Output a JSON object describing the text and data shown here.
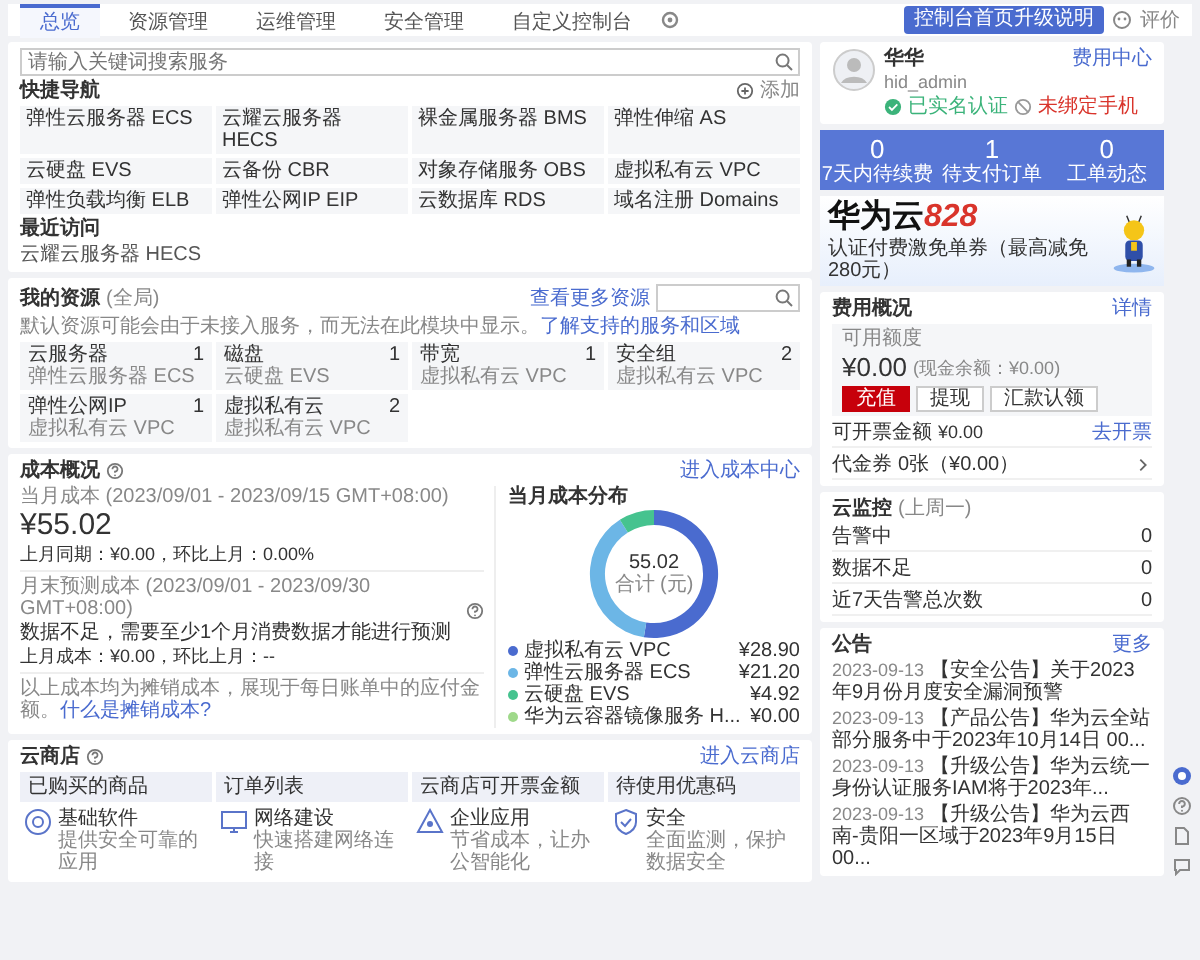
{
  "top_bar": {
    "tabs": [
      {
        "label": "总览",
        "selected": true
      },
      {
        "label": "资源管理",
        "selected": false
      },
      {
        "label": "运维管理",
        "selected": false
      },
      {
        "label": "安全管理",
        "selected": false
      },
      {
        "label": "自定义控制台",
        "selected": false
      }
    ],
    "upgrade_button": "控制台首页升级说明",
    "feedback": "评价"
  },
  "quick_nav": {
    "search": {
      "placeholder": "请输入关键词搜索服务"
    },
    "title": "快捷导航",
    "add": "添加",
    "items": [
      "弹性云服务器 ECS",
      "云耀云服务器 HECS",
      "裸金属服务器 BMS",
      "弹性伸缩 AS",
      "云硬盘 EVS",
      "云备份 CBR",
      "对象存储服务 OBS",
      "虚拟私有云 VPC",
      "弹性负载均衡 ELB",
      "弹性公网IP EIP",
      "云数据库 RDS",
      "域名注册 Domains"
    ],
    "recent_title": "最近访问",
    "recent": [
      "云耀云服务器 HECS"
    ]
  },
  "resources": {
    "title": "我的资源",
    "scope": "(全局)",
    "note": "默认资源可能会由于未接入服务，而无法在此模块中显示。",
    "note_link": "了解支持的服务和区域",
    "more": "查看更多资源",
    "items": [
      {
        "name": "云服务器",
        "service": "弹性云服务器 ECS",
        "count": "1"
      },
      {
        "name": "磁盘",
        "service": "云硬盘 EVS",
        "count": "1"
      },
      {
        "name": "带宽",
        "service": "虚拟私有云 VPC",
        "count": "1"
      },
      {
        "name": "安全组",
        "service": "虚拟私有云 VPC",
        "count": "2"
      },
      {
        "name": "弹性公网IP",
        "service": "虚拟私有云 VPC",
        "count": "1"
      },
      {
        "name": "虚拟私有云",
        "service": "虚拟私有云 VPC",
        "count": "2"
      }
    ]
  },
  "cost": {
    "title": "成本概况",
    "link": "进入成本中心",
    "month_label": "当月成本 (2023/09/01 - 2023/09/15 GMT+08:00)",
    "month_amount": "¥55.02",
    "month_compare": "上月同期：¥0.00，环比上月：0.00%",
    "forecast_label": "月末预测成本 (2023/09/01 - 2023/09/30 GMT+08:00)",
    "forecast_note": "数据不足，需要至少1个月消费数据才能进行预测",
    "forecast_compare": "上月成本：¥0.00，环比上月：--",
    "footer": "以上成本均为摊销成本，展现于每日账单中的应付金额。",
    "footer_link": "什么是摊销成本?",
    "chart_data": {
      "type": "donut",
      "title": "当月成本分布",
      "categories": [
        "虚拟私有云 VPC",
        "弹性云服务器 ECS",
        "云硬盘 EVS",
        "华为云容器镜像服务 H..."
      ],
      "values": [
        28.9,
        21.2,
        4.92,
        0
      ],
      "value_labels": [
        "¥28.90",
        "¥21.20",
        "¥4.92",
        "¥0.00"
      ],
      "legend": "bottom"
    },
    "center_value": "55.02",
    "center_label": "合计 (元)",
    "legend": [
      {
        "color": "#4a6bcf"
      },
      {
        "color": "#6cb6e6"
      },
      {
        "color": "#46c38f"
      },
      {
        "color": "#9fd98a"
      }
    ]
  },
  "store": {
    "title": "云商店",
    "link": "进入云商店",
    "tabs": [
      "已购买的商品",
      "订单列表",
      "云商店可开票金额",
      "待使用优惠码"
    ],
    "items": [
      {
        "kind": "software",
        "title": "基础软件",
        "desc": "提供安全可靠的应用"
      },
      {
        "kind": "network",
        "title": "网络建设",
        "desc": "快速搭建网络连接"
      },
      {
        "kind": "enterprise",
        "title": "企业应用",
        "desc": "节省成本，让办公智能化"
      },
      {
        "kind": "security",
        "title": "安全",
        "desc": "全面监测，保护数据安全"
      }
    ]
  },
  "user": {
    "name": "华华",
    "account": "hid_admin",
    "link": "费用中心",
    "verified": "已实名认证",
    "warning": "未绑定手机"
  },
  "stats": [
    {
      "value": "0",
      "label": "7天内待续费"
    },
    {
      "value": "1",
      "label": "待支付订单"
    },
    {
      "value": "0",
      "label": "工单动态"
    }
  ],
  "banner": {
    "title": "华为云",
    "number": "828",
    "subtitle": "认证付费激免单券（最高减免280元）"
  },
  "billing": {
    "title": "费用概况",
    "link": "详情",
    "balance_label": "可用额度",
    "balance": "¥0.00",
    "cash": "(现金余额：¥0.00)",
    "buttons": [
      "充值",
      "提现",
      "汇款认领"
    ],
    "invoice_label": "可开票金额",
    "invoice": "¥0.00",
    "invoice_link": "去开票",
    "voucher_label": "代金券",
    "voucher": "0张（¥0.00）"
  },
  "monitor": {
    "title": "云监控",
    "period": "(上周一)",
    "rows": [
      {
        "label": "告警中",
        "value": "0"
      },
      {
        "label": "数据不足",
        "value": "0"
      },
      {
        "label": "近7天告警总次数",
        "value": "0"
      }
    ]
  },
  "notices": {
    "title": "公告",
    "more": "更多",
    "items": [
      {
        "date": "2023-09-13",
        "text": "【安全公告】关于2023年9月份月度安全漏洞预警"
      },
      {
        "date": "2023-09-13",
        "text": "【产品公告】华为云全站部分服务中于2023年10月14日 00..."
      },
      {
        "date": "2023-09-13",
        "text": "【升级公告】华为云统一身份认证服务IAM将于2023年..."
      },
      {
        "date": "2023-09-13",
        "text": "【升级公告】华为云西南-贵阳一区域于2023年9月15日00..."
      }
    ]
  }
}
